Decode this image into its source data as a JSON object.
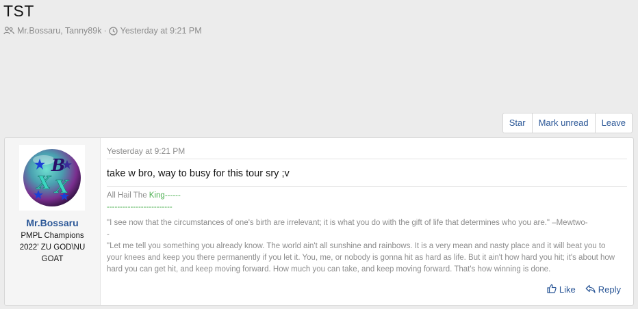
{
  "thread": {
    "title": "TST",
    "participants": "Mr.Bossaru, Tanny89k",
    "separator": "·",
    "time": "Yesterday at 9:21 PM"
  },
  "actions": [
    {
      "label": "Star"
    },
    {
      "label": "Mark unread"
    },
    {
      "label": "Leave"
    }
  ],
  "message": {
    "avatar_letters": "BXX",
    "username": "Mr.Bossaru",
    "user_title": "PMPL Champions 2022' ZU GOD\\NU GOAT",
    "date": "Yesterday at 9:21 PM",
    "body": "take w bro, way to busy for this tour sry ;v",
    "signature": {
      "line1_prefix": "All Hail The ",
      "line1_green": "King",
      "line1_suffix": "------",
      "dash_line": "-------------------------",
      "quote1": "\"I see now that the circumstances of one's birth are irrelevant; it is what you do with the gift of life that determines who you are.\" –Mewtwo-",
      "quote1_tail": "-",
      "quote2": "\"Let me tell you something you already know. The world ain't all sunshine and rainbows. It is a very mean and nasty place and it will beat you to your knees and keep you there permanently if you let it. You, me, or nobody is gonna hit as hard as life. But it ain't how hard you hit; it's about how hard you can get hit, and keep moving forward. How much you can take, and keep moving forward. That's how winning is done."
    },
    "like_label": "Like",
    "reply_label": "Reply"
  },
  "icons": {
    "participants": "users-icon",
    "time": "clock-icon",
    "like": "thumbs-up-icon",
    "reply": "reply-icon"
  },
  "colors": {
    "link": "#2b5797",
    "muted": "#8c8c8c",
    "green": "#4caf50",
    "page_bg": "#ececec"
  }
}
